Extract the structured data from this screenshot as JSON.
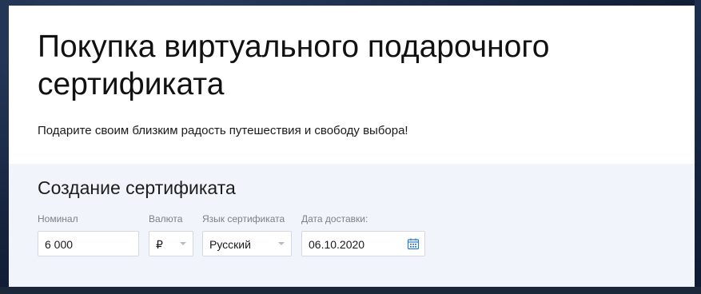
{
  "header": {
    "title": "Покупка виртуального подарочного сертификата",
    "subtitle": "Подарите своим близким радость путешествия и свободу выбора!"
  },
  "form": {
    "section_title": "Создание сертификата",
    "fields": {
      "nominal": {
        "label": "Номинал",
        "value": "6 000"
      },
      "currency": {
        "label": "Валюта",
        "value": "₽"
      },
      "language": {
        "label": "Язык сертификата",
        "value": "Русский"
      },
      "delivery_date": {
        "label": "Дата доставки:",
        "value": "06.10.2020"
      }
    }
  },
  "colors": {
    "accent": "#2f79c9",
    "form_background": "#f1f5fb",
    "label": "#7b7f86",
    "border": "#d4d9e1"
  },
  "icons": {
    "select_arrow": "chevron-down-icon",
    "date_picker": "calendar-icon"
  }
}
